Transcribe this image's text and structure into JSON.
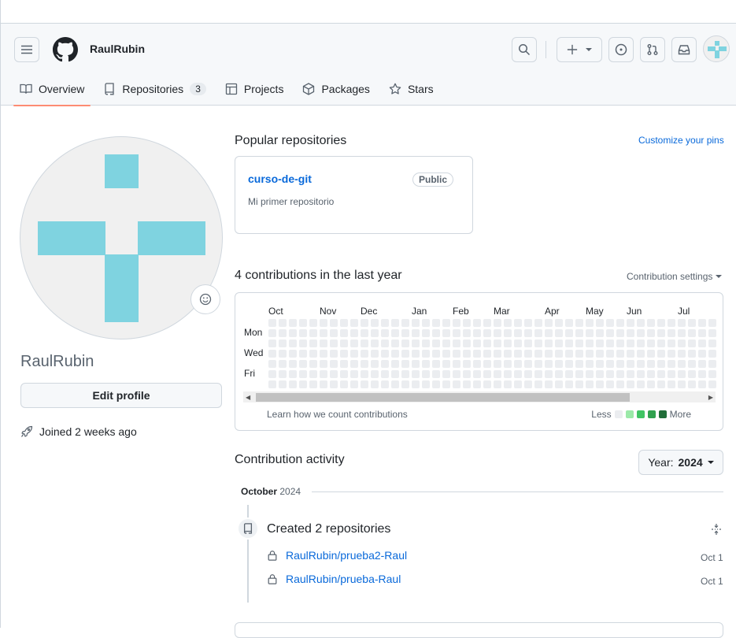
{
  "header": {
    "username": "RaulRubin"
  },
  "tabs": [
    {
      "label": "Overview",
      "icon": "book-icon"
    },
    {
      "label": "Repositories",
      "icon": "repo-icon",
      "count": "3"
    },
    {
      "label": "Projects",
      "icon": "table-icon"
    },
    {
      "label": "Packages",
      "icon": "package-icon"
    },
    {
      "label": "Stars",
      "icon": "star-icon"
    }
  ],
  "profile": {
    "name": "RaulRubin",
    "edit_label": "Edit profile",
    "joined": "Joined 2 weeks ago"
  },
  "popular": {
    "title": "Popular repositories",
    "customize": "Customize your pins",
    "repo_name": "curso-de-git",
    "visibility": "Public",
    "description": "Mi primer repositorio"
  },
  "contributions": {
    "title": "4 contributions in the last year",
    "settings": "Contribution settings",
    "months": [
      "Oct",
      "Nov",
      "Dec",
      "Jan",
      "Feb",
      "Mar",
      "Apr",
      "May",
      "Jun",
      "Jul"
    ],
    "days": [
      "Mon",
      "Wed",
      "Fri"
    ],
    "learn": "Learn how we count contributions",
    "less": "Less",
    "more": "More",
    "legend_colors": [
      "#ebedf0",
      "#9be9a8",
      "#40c463",
      "#30a14e",
      "#216e39"
    ],
    "empty_color": "#ebedf0"
  },
  "activity": {
    "title": "Contribution activity",
    "year_prefix": "Year:",
    "year": "2024",
    "month": "October",
    "month_year": "2024",
    "created": "Created 2 repositories",
    "repos": [
      {
        "name": "RaulRubin/prueba2-Raul",
        "date": "Oct 1"
      },
      {
        "name": "RaulRubin/prueba-Raul",
        "date": "Oct 1"
      }
    ]
  },
  "colors": {
    "avatar_teal": "#7fd3e0",
    "link": "#0969da",
    "tab_underline": "#fd8c73"
  }
}
